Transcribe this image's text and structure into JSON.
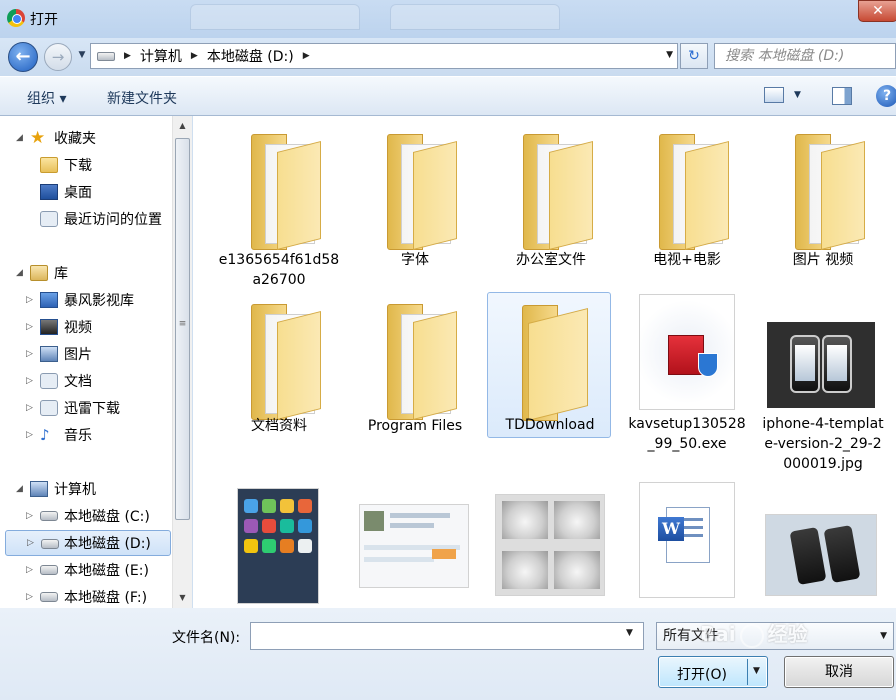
{
  "window": {
    "title": "打开",
    "close_glyph": "✕"
  },
  "nav": {
    "back_glyph": "←",
    "forward_glyph": "→",
    "breadcrumbs": [
      "计算机",
      "本地磁盘 (D:)"
    ],
    "refresh_glyph": "↻",
    "search_placeholder": "搜索 本地磁盘 (D:)"
  },
  "toolbar": {
    "organize_label": "组织 ▾",
    "new_folder_label": "新建文件夹",
    "help_glyph": "?"
  },
  "sidebar": {
    "favorites": {
      "label": "收藏夹",
      "items": [
        {
          "label": "下载",
          "icon": "download-folder-icon"
        },
        {
          "label": "桌面",
          "icon": "desktop-icon"
        },
        {
          "label": "最近访问的位置",
          "icon": "recent-places-icon"
        }
      ]
    },
    "libraries": {
      "label": "库",
      "items": [
        {
          "label": "暴风影视库",
          "icon": "media-library-icon"
        },
        {
          "label": "视频",
          "icon": "video-library-icon"
        },
        {
          "label": "图片",
          "icon": "pictures-library-icon"
        },
        {
          "label": "文档",
          "icon": "documents-library-icon"
        },
        {
          "label": "迅雷下载",
          "icon": "thunder-download-icon"
        },
        {
          "label": "音乐",
          "icon": "music-library-icon"
        }
      ]
    },
    "computer": {
      "label": "计算机",
      "items": [
        {
          "label": "本地磁盘 (C:)",
          "icon": "drive-c-icon"
        },
        {
          "label": "本地磁盘 (D:)",
          "icon": "drive-d-icon",
          "selected": true
        },
        {
          "label": "本地磁盘 (E:)",
          "icon": "drive-e-icon"
        },
        {
          "label": "本地磁盘 (F:)",
          "icon": "drive-f-icon"
        }
      ]
    }
  },
  "files": [
    {
      "name": "e1365654f61d58a26700",
      "type": "folder"
    },
    {
      "name": "字体",
      "type": "folder",
      "glyph": "体"
    },
    {
      "name": "办公室文件",
      "type": "folder"
    },
    {
      "name": "电视+电影",
      "type": "folder"
    },
    {
      "name": "图片  视频",
      "type": "folder"
    },
    {
      "name": "文档资料",
      "type": "folder"
    },
    {
      "name": "Program Files",
      "type": "folder"
    },
    {
      "name": "TDDownload",
      "type": "folder",
      "selected": true
    },
    {
      "name": "kavsetup130528_99_50.exe",
      "type": "exe"
    },
    {
      "name": "iphone-4-template-version-2_29-2000019.jpg",
      "type": "image"
    },
    {
      "name": "",
      "type": "image"
    },
    {
      "name": "",
      "type": "image"
    },
    {
      "name": "",
      "type": "image"
    },
    {
      "name": "",
      "type": "doc"
    },
    {
      "name": "",
      "type": "image"
    }
  ],
  "bottom": {
    "filename_label": "文件名(N):",
    "filename_value": "",
    "filetype_value": "所有文件",
    "open_label": "打开(O)",
    "cancel_label": "取消"
  },
  "watermark": {
    "text_a": "Bai",
    "text_b": "经验"
  }
}
